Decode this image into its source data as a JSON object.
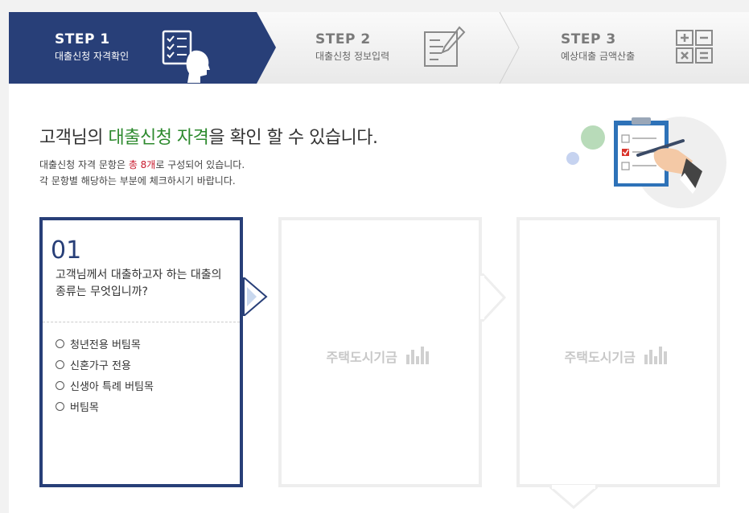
{
  "steps": [
    {
      "num": "STEP 1",
      "label": "대출신청 자격확인",
      "active": true
    },
    {
      "num": "STEP 2",
      "label": "대출신청 정보입력",
      "active": false
    },
    {
      "num": "STEP 3",
      "label": "예상대출 금액산출",
      "active": false
    }
  ],
  "colors": {
    "primary": "#283f78",
    "accent_green": "#2d8a2e",
    "accent_red": "#c8192c"
  },
  "headline": {
    "part1": "고객님의 ",
    "highlight": "대출신청 자격",
    "part2": "을 확인 할 수 있습니다."
  },
  "description": {
    "line1_a": "대출신청 자격 문항은 ",
    "line1_highlight": "총 8개",
    "line1_b": "로 구성되어 있습니다.",
    "line2": "각 문항별 해당하는 부분에 체크하시기 바랍니다."
  },
  "question": {
    "number": "01",
    "text": "고객님께서 대출하고자 하는 대출의 종류는 무엇입니까?",
    "options": [
      "청년전용 버팀목",
      "신혼가구 전용",
      "신생아 특례 버팀목",
      "버팀목"
    ]
  },
  "placeholder_cards": [
    {
      "watermark": "주택도시기금"
    },
    {
      "watermark": "주택도시기금"
    }
  ]
}
